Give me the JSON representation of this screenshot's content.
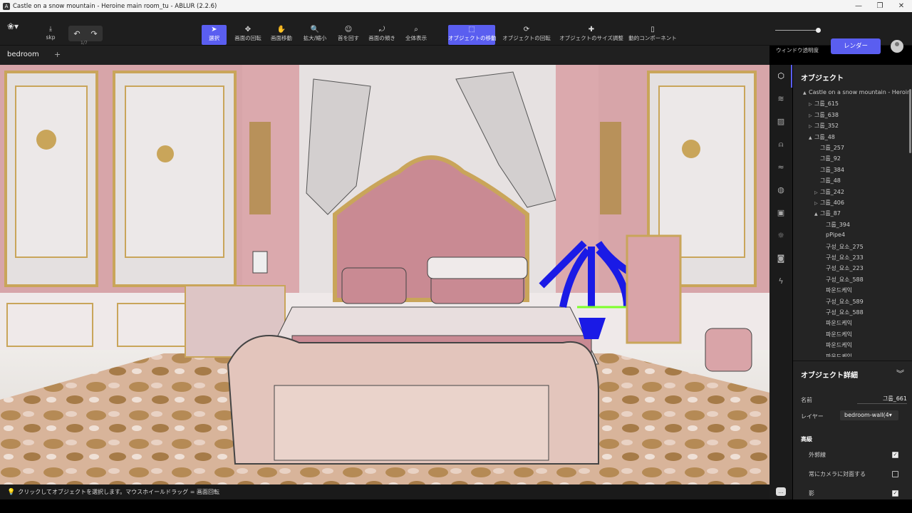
{
  "window": {
    "title": "Castle on a snow mountain - Heroine main room_tu - ABLUR (2.2.6)",
    "minimize": "—",
    "maximize": "❐",
    "close": "✕"
  },
  "toolbar": {
    "skp_label": "skp",
    "undo_count": "1/7",
    "tools": [
      {
        "id": "select",
        "label": "選択",
        "icon": "pointer-icon",
        "glyph": "➤",
        "active": true
      },
      {
        "id": "rotate",
        "label": "画面の回転",
        "icon": "rotate-icon",
        "glyph": "✥",
        "active": false
      },
      {
        "id": "pan",
        "label": "画面移動",
        "icon": "hand-icon",
        "glyph": "✋",
        "active": false
      },
      {
        "id": "zoom",
        "label": "拡大/縮小",
        "icon": "magnifier-icon",
        "glyph": "🔍",
        "active": false
      },
      {
        "id": "turn-head",
        "label": "首を回す",
        "icon": "head-turn-icon",
        "glyph": "☺",
        "active": false
      },
      {
        "id": "tilt",
        "label": "画面の傾き",
        "icon": "tilt-icon",
        "glyph": "⤾",
        "active": false
      },
      {
        "id": "fit-all",
        "label": "全体表示",
        "icon": "fit-icon",
        "glyph": "⌕",
        "active": false
      },
      {
        "id": "move-object",
        "label": "オブジェクトの移動",
        "icon": "move-object-icon",
        "glyph": "⬚",
        "active": true
      },
      {
        "id": "rotate-object",
        "label": "オブジェクトの回転",
        "icon": "rotate-object-icon",
        "glyph": "⟳",
        "active": false
      },
      {
        "id": "scale-object",
        "label": "オブジェクトのサイズ調整",
        "icon": "scale-object-icon",
        "glyph": "✚",
        "active": false
      },
      {
        "id": "dynamic-component",
        "label": "動的コンポーネント",
        "icon": "dynamic-component-icon",
        "glyph": "▯",
        "active": false
      }
    ],
    "transparency_label": "ウィンドウ透明度",
    "transparency_value": 0.95,
    "render_label": "レンダー"
  },
  "tabs": {
    "active": "bedroom",
    "add": "+"
  },
  "status": {
    "hint": "クリックしてオブジェクトを選択します。マウスホイールドラッグ = 画面回転"
  },
  "side_icons": [
    "cube-icon",
    "layers-icon",
    "material-icon",
    "person-icon",
    "wind-icon",
    "globe-icon",
    "image-icon",
    "sun-icon",
    "camera-icon",
    "lightning-icon"
  ],
  "outliner": {
    "title": "オブジェクト",
    "rows": [
      {
        "label": "Castle on a snow mountain - Heroine",
        "depth": 0,
        "arrow": "▲"
      },
      {
        "label": "그룹_615",
        "depth": 1,
        "arrow": "▷"
      },
      {
        "label": "그룹_638",
        "depth": 1,
        "arrow": "▷"
      },
      {
        "label": "그룹_352",
        "depth": 1,
        "arrow": "▷"
      },
      {
        "label": "그룹_48",
        "depth": 1,
        "arrow": "▲"
      },
      {
        "label": "그룹_257",
        "depth": 2,
        "arrow": ""
      },
      {
        "label": "그룹_92",
        "depth": 2,
        "arrow": ""
      },
      {
        "label": "그룹_384",
        "depth": 2,
        "arrow": ""
      },
      {
        "label": "그룹_48",
        "depth": 2,
        "arrow": ""
      },
      {
        "label": "그룹_242",
        "depth": 2,
        "arrow": "▷"
      },
      {
        "label": "그룹_406",
        "depth": 2,
        "arrow": "▷"
      },
      {
        "label": "그룹_87",
        "depth": 2,
        "arrow": "▲"
      },
      {
        "label": "그룹_394",
        "depth": 3,
        "arrow": ""
      },
      {
        "label": "pPipe4",
        "depth": 3,
        "arrow": ""
      },
      {
        "label": "구성_요소_275",
        "depth": 3,
        "arrow": ""
      },
      {
        "label": "구성_요소_233",
        "depth": 3,
        "arrow": ""
      },
      {
        "label": "구성_요소_223",
        "depth": 3,
        "arrow": ""
      },
      {
        "label": "구성_요소_588",
        "depth": 3,
        "arrow": ""
      },
      {
        "label": "파운드케익",
        "depth": 3,
        "arrow": ""
      },
      {
        "label": "구성_요소_589",
        "depth": 3,
        "arrow": ""
      },
      {
        "label": "구성_요소_588",
        "depth": 3,
        "arrow": ""
      },
      {
        "label": "파운드케익",
        "depth": 3,
        "arrow": ""
      },
      {
        "label": "파운드케익",
        "depth": 3,
        "arrow": ""
      },
      {
        "label": "파운드케익",
        "depth": 3,
        "arrow": ""
      },
      {
        "label": "파운드케익",
        "depth": 3,
        "arrow": ""
      }
    ]
  },
  "details": {
    "title": "オブジェクト詳細",
    "chevron": "︾",
    "name_label": "名前",
    "name_value": "그룹_661",
    "layer_label": "レイヤー",
    "layer_value": "bedroom-wall(4",
    "advanced_label": "高級",
    "options": [
      {
        "label": "外郭線",
        "checked": true
      },
      {
        "label": "常にカメラに対面する",
        "checked": false
      },
      {
        "label": "影",
        "checked": true
      }
    ]
  },
  "colors": {
    "accent": "#5a5ef0",
    "wall_pink": "#d9a4a8",
    "marble": "#e6e1e1",
    "gold": "#c9a55a",
    "headboard": "#c98a93",
    "selection_blue": "#1a1ae6",
    "gizmo_green": "#7cff2a"
  }
}
